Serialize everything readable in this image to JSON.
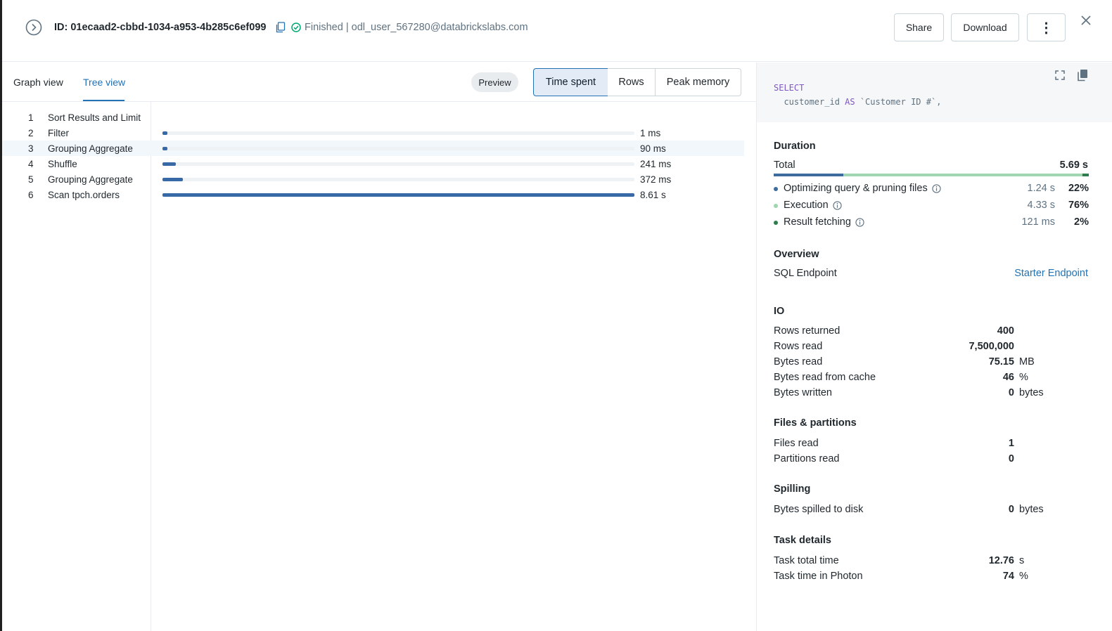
{
  "header": {
    "title": "ID: 01ecaad2-cbbd-1034-a953-4b285c6ef099",
    "status": "Finished | odl_user_567280@databrickslabs.com",
    "share_label": "Share",
    "download_label": "Download",
    "more_label": "⋮"
  },
  "tabs": {
    "graph_view": "Graph view",
    "tree_view": "Tree view",
    "active": "Tree view"
  },
  "preview_label": "Preview",
  "metric_toggle": {
    "time_spent": "Time spent",
    "rows": "Rows",
    "peak_memory": "Peak memory",
    "selected": "Time spent"
  },
  "tree": [
    {
      "num": "1",
      "name": "Sort Results and Limit",
      "value": "",
      "fraction": null
    },
    {
      "num": "2",
      "name": "Filter",
      "value": "1 ms",
      "fraction": 0.0001
    },
    {
      "num": "3",
      "name": "Grouping Aggregate",
      "value": "90 ms",
      "fraction": 0.0105
    },
    {
      "num": "4",
      "name": "Shuffle",
      "value": "241 ms",
      "fraction": 0.028
    },
    {
      "num": "5",
      "name": "Grouping Aggregate",
      "value": "372 ms",
      "fraction": 0.0432
    },
    {
      "num": "6",
      "name": "Scan tpch.orders",
      "value": "8.61 s",
      "fraction": 1.0
    }
  ],
  "query": {
    "line1_keyword": "SELECT",
    "line2_pre": "customer_id ",
    "line2_keyword": "AS",
    "line2_post": " `Customer ID #`,"
  },
  "duration": {
    "title": "Duration",
    "total_label": "Total",
    "total_value": "5.69 s",
    "items": [
      {
        "label": "Optimizing query & pruning files",
        "time": "1.24 s",
        "pct": "22%",
        "share": 0.22,
        "color": "#3d6b9e"
      },
      {
        "label": "Execution",
        "time": "4.33 s",
        "pct": "76%",
        "share": 0.76,
        "color": "#9fd6b1"
      },
      {
        "label": "Result fetching",
        "time": "121 ms",
        "pct": "2%",
        "share": 0.02,
        "color": "#2e7d4f"
      }
    ]
  },
  "overview": {
    "title": "Overview",
    "endpoint_label": "SQL Endpoint",
    "endpoint_value": "Starter Endpoint"
  },
  "io": {
    "title": "IO",
    "rows": [
      {
        "label": "Rows returned",
        "value": "400",
        "unit": ""
      },
      {
        "label": "Rows read",
        "value": "7,500,000",
        "unit": ""
      },
      {
        "label": "Bytes read",
        "value": "75.15",
        "unit": "MB"
      },
      {
        "label": "Bytes read from cache",
        "value": "46",
        "unit": "%"
      },
      {
        "label": "Bytes written",
        "value": "0",
        "unit": "bytes"
      }
    ]
  },
  "files": {
    "title": "Files & partitions",
    "rows": [
      {
        "label": "Files read",
        "value": "1",
        "unit": ""
      },
      {
        "label": "Partitions read",
        "value": "0",
        "unit": ""
      }
    ]
  },
  "spilling": {
    "title": "Spilling",
    "rows": [
      {
        "label": "Bytes spilled to disk",
        "value": "0",
        "unit": "bytes"
      }
    ]
  },
  "tasks": {
    "title": "Task details",
    "rows": [
      {
        "label": "Task total time",
        "value": "12.76",
        "unit": "s"
      },
      {
        "label": "Task time in Photon",
        "value": "74",
        "unit": "%"
      }
    ]
  },
  "colors": {
    "accent": "#2272b4",
    "bar": "#3869a7",
    "keyword": "#7e57c2",
    "success": "#00a972"
  }
}
